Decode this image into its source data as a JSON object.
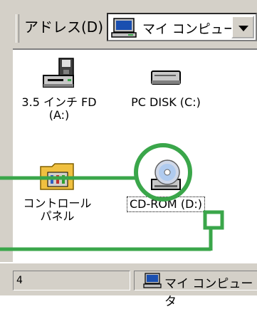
{
  "toolbar": {
    "address_label": "アドレス(D)",
    "address_value": "マイ コンピュータ"
  },
  "icons": [
    {
      "id": "floppy",
      "label_line1": "3.5 インチ FD",
      "label_line2": "(A:)"
    },
    {
      "id": "pcdisk",
      "label_line1": "PC DISK (C:)",
      "label_line2": ""
    },
    {
      "id": "control",
      "label_line1": "コントロール",
      "label_line2": "パネル"
    },
    {
      "id": "cdrom",
      "label_prefix": "CD-ROM ",
      "label_highlight": "(D:)"
    }
  ],
  "status": {
    "left_value": "4",
    "right_value": "マイ コンピュータ"
  },
  "annotation_color": "#3aa64a"
}
